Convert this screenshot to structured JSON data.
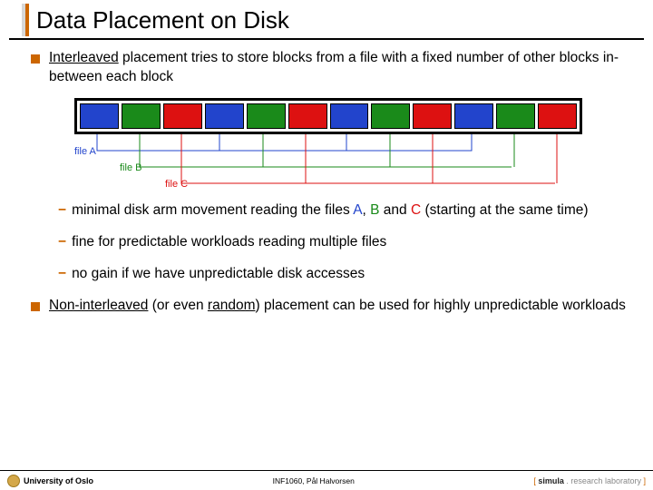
{
  "title": "Data Placement on Disk",
  "bullets": {
    "b1_pre": "Interleaved",
    "b1_rest": " placement tries to store blocks from a file with a fixed number of other blocks in-between each block",
    "s1_pre": "minimal disk arm movement reading the files ",
    "s1_a": "A",
    "s1_mid1": ", ",
    "s1_b": "B",
    "s1_mid2": " and ",
    "s1_c": "C",
    "s1_post": " (starting at the same time)",
    "s2": "fine for predictable workloads reading multiple files",
    "s3": "no gain if we have unpredictable disk accesses",
    "b2_pre": "Non-interleaved",
    "b2_mid": " (or even ",
    "b2_rand": "random",
    "b2_post": ") placement can be used for highly unpredictable workloads"
  },
  "labels": {
    "fileA": "file A",
    "fileB": "file B",
    "fileC": "file C"
  },
  "footer": {
    "uio": "University of Oslo",
    "center": "INF1060, Pål Halvorsen",
    "sim_open": "[ ",
    "sim_bold": "simula",
    "sim_mid": " . ",
    "sim_gray": "research laboratory",
    "sim_close": " ]"
  }
}
